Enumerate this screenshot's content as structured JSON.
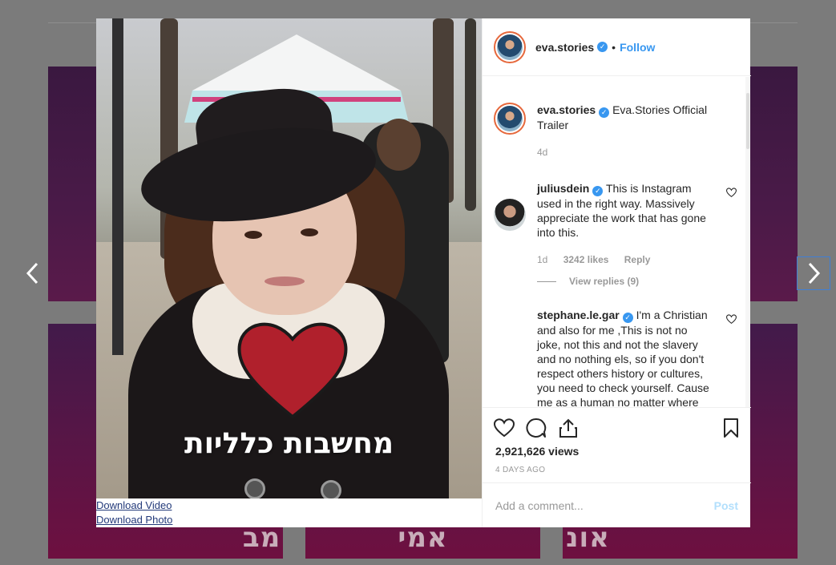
{
  "background": {
    "tile_text_1": "מב",
    "tile_text_2": "וסט על סיפור אמי",
    "tile_text_3": "אונ"
  },
  "video": {
    "caption": "מחשבות כלליות"
  },
  "downloads": {
    "video_label": "Download Video",
    "photo_label": "Download Photo"
  },
  "header": {
    "username": "eva.stories",
    "separator": "•",
    "follow_label": "Follow"
  },
  "post_caption": {
    "username": "eva.stories",
    "text": "Eva.Stories Official Trailer",
    "time": "4d"
  },
  "comments": [
    {
      "username": "juliusdein",
      "text": "This is Instagram used in the right way. Massively appreciate the work that has gone into this.",
      "time": "1d",
      "likes": "3242 likes",
      "reply_label": "Reply",
      "view_replies": "View replies (9)"
    },
    {
      "username": "stephane.le.gar",
      "text": "I'm a Christian and also for me ,This is not no joke, not this and not the slavery and no nothing els, so if you don't respect others history or cultures, you need to check yourself. Cause me as a human no matter where I'm from I will"
    }
  ],
  "stats": {
    "views": "2,921,626 views",
    "posted_ago": "4 DAYS AGO"
  },
  "comment_box": {
    "placeholder": "Add a comment...",
    "post_label": "Post"
  },
  "icons": {
    "prev": "chevron-left-icon",
    "next": "chevron-right-icon",
    "like": "heart-icon",
    "comment": "comment-icon",
    "share": "share-icon",
    "save": "bookmark-icon"
  },
  "colors": {
    "accent": "#3897f0",
    "heart_red": "#b0202c",
    "post_disabled": "#b2dffc"
  }
}
